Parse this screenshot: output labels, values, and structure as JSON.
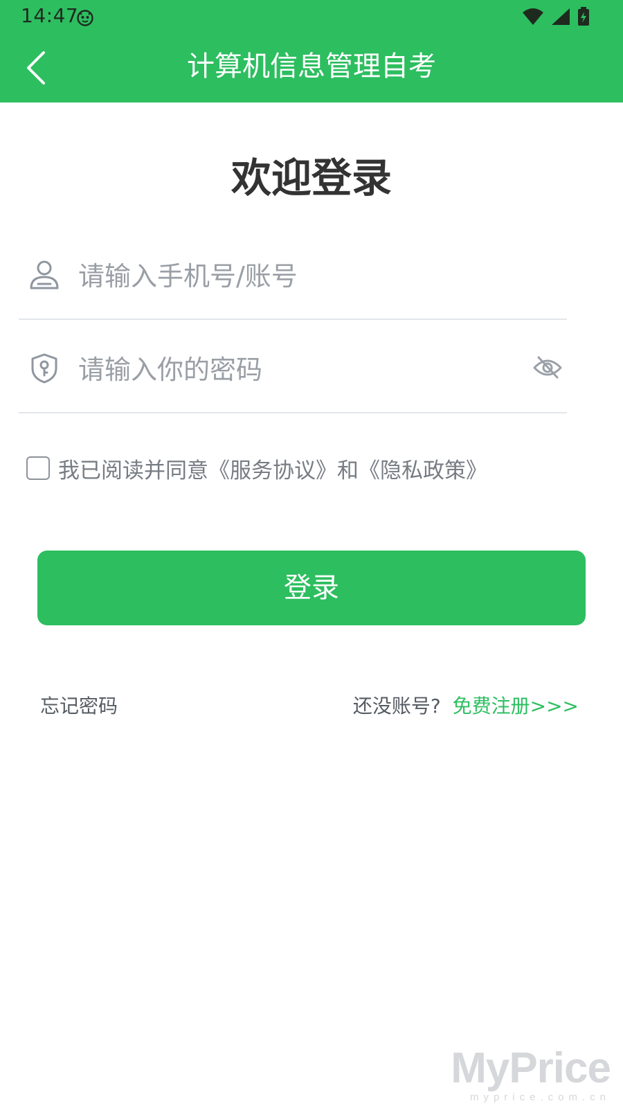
{
  "status_bar": {
    "time": "14:47",
    "icons": [
      "app-badge-icon",
      "wifi-icon",
      "signal-icon",
      "battery-charging-icon"
    ]
  },
  "header": {
    "title": "计算机信息管理自考",
    "back_icon": "chevron-left-icon",
    "background_color": "#2dbe60"
  },
  "login": {
    "welcome": "欢迎登录",
    "username": {
      "placeholder": "请输入手机号/账号",
      "value": "",
      "icon": "user-icon"
    },
    "password": {
      "placeholder": "请输入你的密码",
      "value": "",
      "icon": "shield-key-icon",
      "toggle_icon": "eye-off-icon"
    },
    "agreement": {
      "checked": false,
      "text": "我已阅读并同意《服务协议》和《隐私政策》"
    },
    "submit_label": "登录",
    "forgot_label": "忘记密码",
    "no_account_label": "还没账号?",
    "register_label": "免费注册>>>",
    "accent_color": "#2dbe60"
  },
  "watermark": {
    "main": "MyPrice",
    "sub": "myprice.com.cn"
  }
}
